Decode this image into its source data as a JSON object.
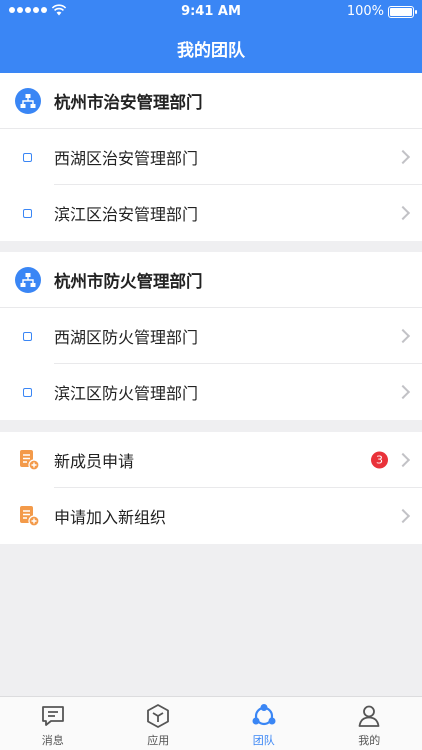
{
  "status_bar": {
    "time": "9:41 AM",
    "battery": "100%"
  },
  "header": {
    "title": "我的团队"
  },
  "groups": [
    {
      "title": "杭州市治安管理部门",
      "items": [
        "西湖区治安管理部门",
        "滨江区治安管理部门"
      ]
    },
    {
      "title": "杭州市防火管理部门",
      "items": [
        "西湖区防火管理部门",
        "滨江区防火管理部门"
      ]
    }
  ],
  "actions": [
    {
      "label": "新成员申请",
      "badge": "3"
    },
    {
      "label": "申请加入新组织"
    }
  ],
  "tabs": [
    {
      "label": "消息",
      "icon": "message-icon"
    },
    {
      "label": "应用",
      "icon": "cube-icon"
    },
    {
      "label": "团队",
      "icon": "team-icon",
      "active": true
    },
    {
      "label": "我的",
      "icon": "person-icon"
    }
  ],
  "colors": {
    "accent": "#3a86f5",
    "badge": "#e9323a",
    "doc_icon": "#f39a4a"
  }
}
